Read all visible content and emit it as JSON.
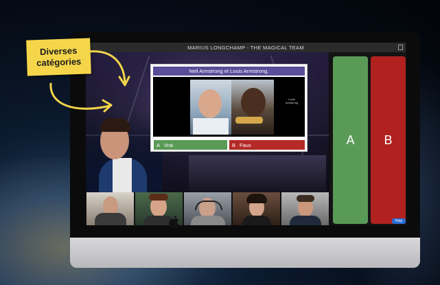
{
  "sticker": {
    "line1": "Diverses",
    "line2": "catégories"
  },
  "window": {
    "title": "MARIUS LONGCHAMP - THE MAGICAL TEAM"
  },
  "question": {
    "title": "Neil Armstrong et Louis Armstrong.",
    "image_tag": "Louis Armstrong",
    "answers": [
      {
        "letter": "A",
        "label": "Vrai",
        "color": "#5a9a57"
      },
      {
        "letter": "B",
        "label": "Faux",
        "color": "#b42a27"
      }
    ]
  },
  "side_panel": {
    "buttons": [
      {
        "label": "A",
        "color": "#5a9a57"
      },
      {
        "label": "B",
        "color": "#b1211f"
      }
    ],
    "help_label": "Help"
  },
  "participants": [
    {
      "tile": "participant-1"
    },
    {
      "tile": "participant-2"
    },
    {
      "tile": "participant-3"
    },
    {
      "tile": "participant-4"
    },
    {
      "tile": "participant-5"
    }
  ],
  "colors": {
    "sticker": "#f5d64a",
    "question_header": "#5c4d99"
  }
}
